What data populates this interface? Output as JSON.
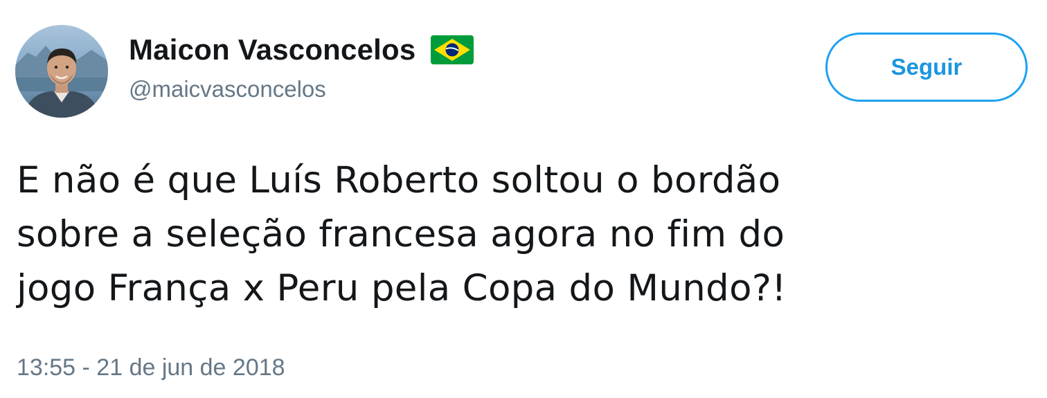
{
  "user": {
    "display_name": "Maicon Vasconcelos",
    "handle": "@maicvasconcelos",
    "flag_icon": "brazil-flag-icon",
    "avatar_icon": "user-avatar"
  },
  "follow_button": {
    "label": "Seguir"
  },
  "tweet": {
    "lines": [
      "E não é que Luís Roberto soltou o bordão",
      "sobre a seleção francesa agora no fim do",
      "jogo França x Peru pela Copa do Mundo?!"
    ],
    "timestamp": "13:55 - 21 de jun de 2018"
  },
  "colors": {
    "accent": "#1da1f2",
    "text": "#14171a",
    "secondary_text": "#657786",
    "flag_green": "#009c3b",
    "flag_yellow": "#ffdf00",
    "flag_blue": "#002776"
  }
}
